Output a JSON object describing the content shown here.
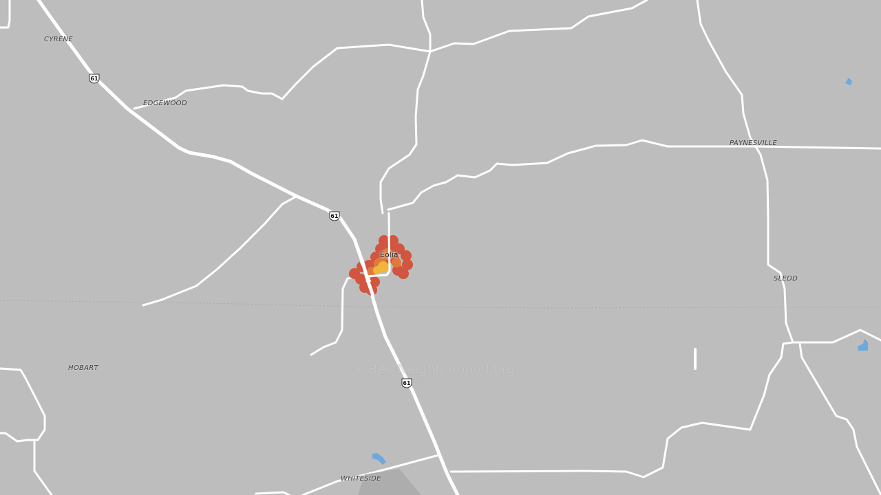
{
  "map": {
    "background_color": "#bdbdbd",
    "road_color": "#ffffff",
    "water_color": "#6fa8dc",
    "heat_colors": [
      "#d1553f",
      "#e07a3c",
      "#f0b53a"
    ]
  },
  "places": {
    "cyrene": "CYRENE",
    "edgewood": "EDGEWOOD",
    "paynesville": "PAYNESVILLE",
    "sledd": "SLEDD",
    "hobart": "HOBART",
    "whiteside": "WHITESIDE"
  },
  "town": {
    "name": "Eolia"
  },
  "route": {
    "number": "61"
  },
  "watermark": "©BestNeighborhood.org"
}
